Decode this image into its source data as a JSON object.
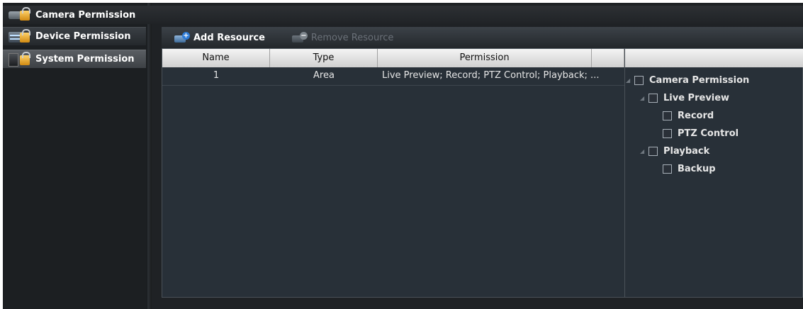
{
  "sidebar": {
    "items": [
      {
        "label": "Camera Permission",
        "icon": "camera-lock-icon"
      },
      {
        "label": "Device Permission",
        "icon": "device-lock-icon"
      },
      {
        "label": "System Permission",
        "icon": "system-lock-icon"
      }
    ]
  },
  "toolbar": {
    "add_label": "Add Resource",
    "remove_label": "Remove Resource"
  },
  "table": {
    "headers": [
      "Name",
      "Type",
      "Permission",
      ""
    ],
    "rows": [
      {
        "name": "1",
        "type": "Area",
        "permission": "Live Preview; Record; PTZ Control; Playback; ..."
      }
    ]
  },
  "tree": {
    "root": "Camera Permission",
    "live_preview": "Live Preview",
    "record": "Record",
    "ptz_control": "PTZ Control",
    "playback": "Playback",
    "backup": "Backup"
  },
  "colors": {
    "background": "#1f2225",
    "add_badge": "#2e7bd6",
    "disabled_text": "#6a7078"
  }
}
